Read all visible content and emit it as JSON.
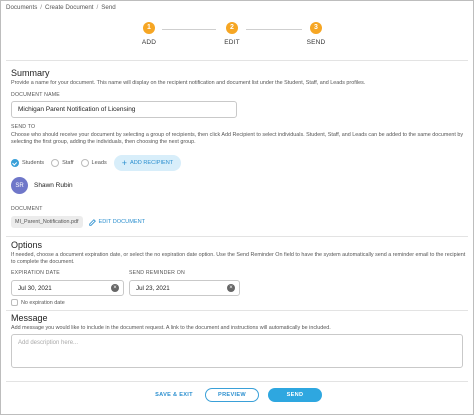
{
  "breadcrumb": [
    "Documents",
    "Create Document",
    "Send"
  ],
  "steps": [
    {
      "num": "1",
      "label": "ADD"
    },
    {
      "num": "2",
      "label": "EDIT"
    },
    {
      "num": "3",
      "label": "SEND"
    }
  ],
  "summary": {
    "title": "Summary",
    "description": "Provide a name for your document. This name will display on the recipient notification and document list under the Student, Staff, and Leads profiles.",
    "doc_name_label": "DOCUMENT NAME",
    "doc_name_value": "Michigan Parent Notification of Licensing",
    "send_to_label": "SEND TO",
    "send_to_description": "Choose who should receive your document by selecting a group of recipients, then click Add Recipient to select individuals. Student, Staff, and Leads can be added to the same document by selecting the first group, adding the individuals, then choosing the next group.",
    "radios": [
      {
        "label": "Students",
        "selected": true
      },
      {
        "label": "Staff",
        "selected": false
      },
      {
        "label": "Leads",
        "selected": false
      }
    ],
    "add_recipient_label": "ADD RECIPIENT",
    "recipient": {
      "initials": "SR",
      "name": "Shawn Rubin",
      "avatar_color": "#6f77c9"
    },
    "document_label": "DOCUMENT",
    "document_file": "MI_Parent_Notification.pdf",
    "edit_document_label": "EDIT DOCUMENT"
  },
  "options": {
    "title": "Options",
    "description": "If needed, choose a document expiration date, or select the no expiration date option. Use the Send Reminder On field to have the system automatically send a reminder email to the recipient to complete the document.",
    "expiration_label": "EXPIRATION DATE",
    "expiration_value": "Jul 30, 2021",
    "reminder_label": "SEND REMINDER ON",
    "reminder_value": "Jul 23, 2021",
    "no_expiration_label": "No expiration date"
  },
  "message": {
    "title": "Message",
    "description": "Add message you would like to include in the document request. A link to the document and instructions will automatically be included.",
    "placeholder": "Add description here..."
  },
  "footer": {
    "save_exit": "SAVE & EXIT",
    "preview": "PREVIEW",
    "send": "SEND"
  },
  "colors": {
    "accent": "#2ea7e0",
    "step": "#f6a623"
  }
}
